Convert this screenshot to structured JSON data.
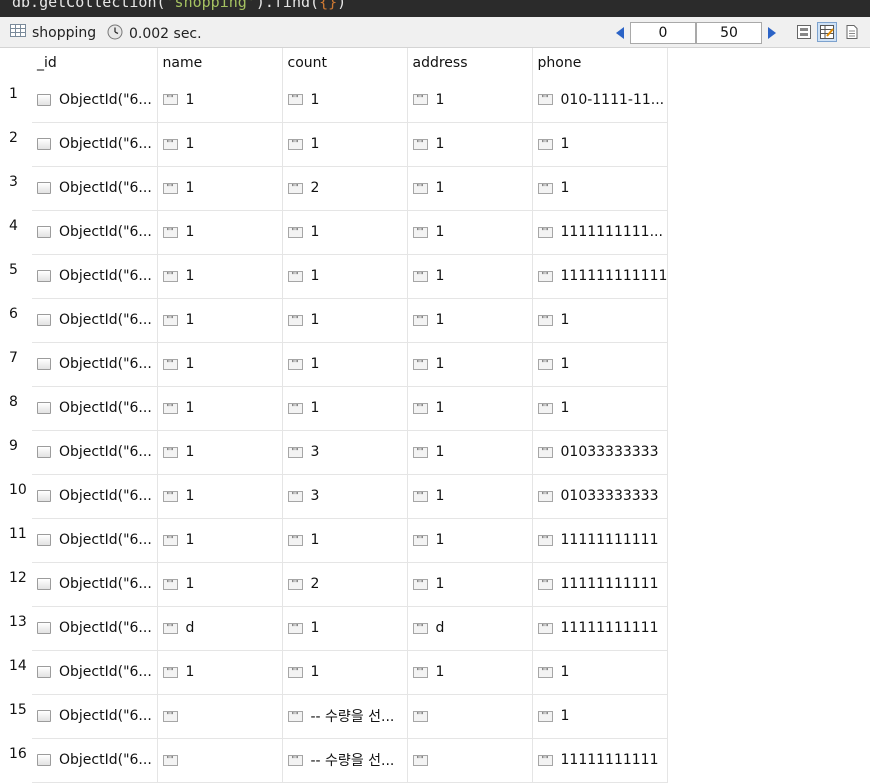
{
  "editor": {
    "prefix": "db.getCollection(",
    "arg": "'shopping'",
    "mid": ").find(",
    "braces": "{}",
    "suffix": ")"
  },
  "toolbar": {
    "collection": "shopping",
    "time": "0.002 sec.",
    "skip": "0",
    "limit": "50",
    "icons": [
      "table-icon",
      "clock-icon",
      "prev-page-icon",
      "next-page-icon",
      "tree-view-icon",
      "table-view-icon",
      "text-view-icon"
    ]
  },
  "columns": [
    "_id",
    "name",
    "count",
    "address",
    "phone"
  ],
  "rows": [
    {
      "n": "1",
      "id": "ObjectId(\"6...",
      "name": "1",
      "count": "1",
      "address": "1",
      "phone": "010-1111-11..."
    },
    {
      "n": "2",
      "id": "ObjectId(\"6...",
      "name": "1",
      "count": "1",
      "address": "1",
      "phone": "1"
    },
    {
      "n": "3",
      "id": "ObjectId(\"6...",
      "name": "1",
      "count": "2",
      "address": "1",
      "phone": "1"
    },
    {
      "n": "4",
      "id": "ObjectId(\"6...",
      "name": "1",
      "count": "1",
      "address": "1",
      "phone": "1111111111..."
    },
    {
      "n": "5",
      "id": "ObjectId(\"6...",
      "name": "1",
      "count": "1",
      "address": "1",
      "phone": "111111111111"
    },
    {
      "n": "6",
      "id": "ObjectId(\"6...",
      "name": "1",
      "count": "1",
      "address": "1",
      "phone": "1"
    },
    {
      "n": "7",
      "id": "ObjectId(\"6...",
      "name": "1",
      "count": "1",
      "address": "1",
      "phone": "1"
    },
    {
      "n": "8",
      "id": "ObjectId(\"6...",
      "name": "1",
      "count": "1",
      "address": "1",
      "phone": "1"
    },
    {
      "n": "9",
      "id": "ObjectId(\"6...",
      "name": "1",
      "count": "3",
      "address": "1",
      "phone": "01033333333"
    },
    {
      "n": "10",
      "id": "ObjectId(\"6...",
      "name": "1",
      "count": "3",
      "address": "1",
      "phone": "01033333333"
    },
    {
      "n": "11",
      "id": "ObjectId(\"6...",
      "name": "1",
      "count": "1",
      "address": "1",
      "phone": "11111111111"
    },
    {
      "n": "12",
      "id": "ObjectId(\"6...",
      "name": "1",
      "count": "2",
      "address": "1",
      "phone": "11111111111"
    },
    {
      "n": "13",
      "id": "ObjectId(\"6...",
      "name": "d",
      "count": "1",
      "address": "d",
      "phone": "11111111111"
    },
    {
      "n": "14",
      "id": "ObjectId(\"6...",
      "name": "1",
      "count": "1",
      "address": "1",
      "phone": "1"
    },
    {
      "n": "15",
      "id": "ObjectId(\"6...",
      "name": "",
      "count": "-- 수량을 선...",
      "address": "",
      "phone": "1"
    },
    {
      "n": "16",
      "id": "ObjectId(\"6...",
      "name": "",
      "count": "-- 수량을 선...",
      "address": "",
      "phone": "11111111111"
    }
  ]
}
